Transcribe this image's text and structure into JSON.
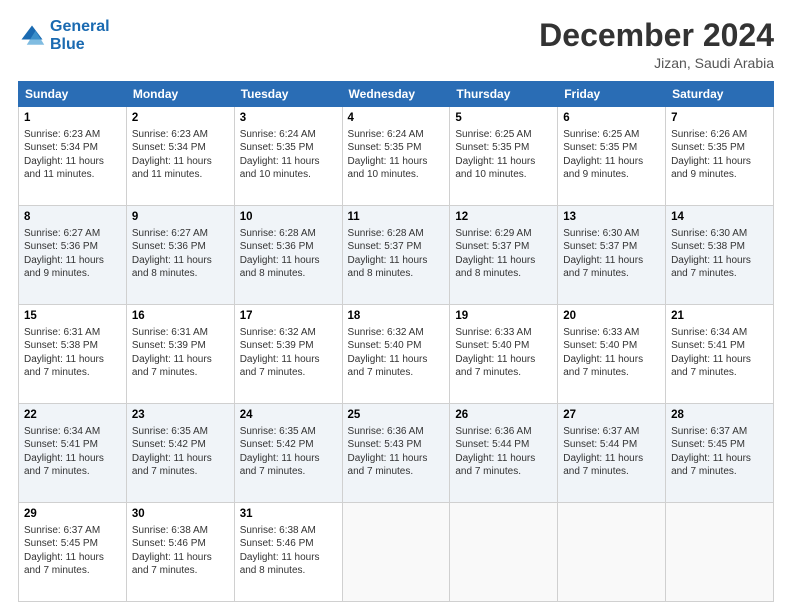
{
  "header": {
    "logo_line1": "General",
    "logo_line2": "Blue",
    "month_title": "December 2024",
    "location": "Jizan, Saudi Arabia"
  },
  "weekdays": [
    "Sunday",
    "Monday",
    "Tuesday",
    "Wednesday",
    "Thursday",
    "Friday",
    "Saturday"
  ],
  "weeks": [
    [
      {
        "day": "1",
        "sunrise": "6:23 AM",
        "sunset": "5:34 PM",
        "daylight": "11 hours and 11 minutes."
      },
      {
        "day": "2",
        "sunrise": "6:23 AM",
        "sunset": "5:34 PM",
        "daylight": "11 hours and 11 minutes."
      },
      {
        "day": "3",
        "sunrise": "6:24 AM",
        "sunset": "5:35 PM",
        "daylight": "11 hours and 10 minutes."
      },
      {
        "day": "4",
        "sunrise": "6:24 AM",
        "sunset": "5:35 PM",
        "daylight": "11 hours and 10 minutes."
      },
      {
        "day": "5",
        "sunrise": "6:25 AM",
        "sunset": "5:35 PM",
        "daylight": "11 hours and 10 minutes."
      },
      {
        "day": "6",
        "sunrise": "6:25 AM",
        "sunset": "5:35 PM",
        "daylight": "11 hours and 9 minutes."
      },
      {
        "day": "7",
        "sunrise": "6:26 AM",
        "sunset": "5:35 PM",
        "daylight": "11 hours and 9 minutes."
      }
    ],
    [
      {
        "day": "8",
        "sunrise": "6:27 AM",
        "sunset": "5:36 PM",
        "daylight": "11 hours and 9 minutes."
      },
      {
        "day": "9",
        "sunrise": "6:27 AM",
        "sunset": "5:36 PM",
        "daylight": "11 hours and 8 minutes."
      },
      {
        "day": "10",
        "sunrise": "6:28 AM",
        "sunset": "5:36 PM",
        "daylight": "11 hours and 8 minutes."
      },
      {
        "day": "11",
        "sunrise": "6:28 AM",
        "sunset": "5:37 PM",
        "daylight": "11 hours and 8 minutes."
      },
      {
        "day": "12",
        "sunrise": "6:29 AM",
        "sunset": "5:37 PM",
        "daylight": "11 hours and 8 minutes."
      },
      {
        "day": "13",
        "sunrise": "6:30 AM",
        "sunset": "5:37 PM",
        "daylight": "11 hours and 7 minutes."
      },
      {
        "day": "14",
        "sunrise": "6:30 AM",
        "sunset": "5:38 PM",
        "daylight": "11 hours and 7 minutes."
      }
    ],
    [
      {
        "day": "15",
        "sunrise": "6:31 AM",
        "sunset": "5:38 PM",
        "daylight": "11 hours and 7 minutes."
      },
      {
        "day": "16",
        "sunrise": "6:31 AM",
        "sunset": "5:39 PM",
        "daylight": "11 hours and 7 minutes."
      },
      {
        "day": "17",
        "sunrise": "6:32 AM",
        "sunset": "5:39 PM",
        "daylight": "11 hours and 7 minutes."
      },
      {
        "day": "18",
        "sunrise": "6:32 AM",
        "sunset": "5:40 PM",
        "daylight": "11 hours and 7 minutes."
      },
      {
        "day": "19",
        "sunrise": "6:33 AM",
        "sunset": "5:40 PM",
        "daylight": "11 hours and 7 minutes."
      },
      {
        "day": "20",
        "sunrise": "6:33 AM",
        "sunset": "5:40 PM",
        "daylight": "11 hours and 7 minutes."
      },
      {
        "day": "21",
        "sunrise": "6:34 AM",
        "sunset": "5:41 PM",
        "daylight": "11 hours and 7 minutes."
      }
    ],
    [
      {
        "day": "22",
        "sunrise": "6:34 AM",
        "sunset": "5:41 PM",
        "daylight": "11 hours and 7 minutes."
      },
      {
        "day": "23",
        "sunrise": "6:35 AM",
        "sunset": "5:42 PM",
        "daylight": "11 hours and 7 minutes."
      },
      {
        "day": "24",
        "sunrise": "6:35 AM",
        "sunset": "5:42 PM",
        "daylight": "11 hours and 7 minutes."
      },
      {
        "day": "25",
        "sunrise": "6:36 AM",
        "sunset": "5:43 PM",
        "daylight": "11 hours and 7 minutes."
      },
      {
        "day": "26",
        "sunrise": "6:36 AM",
        "sunset": "5:44 PM",
        "daylight": "11 hours and 7 minutes."
      },
      {
        "day": "27",
        "sunrise": "6:37 AM",
        "sunset": "5:44 PM",
        "daylight": "11 hours and 7 minutes."
      },
      {
        "day": "28",
        "sunrise": "6:37 AM",
        "sunset": "5:45 PM",
        "daylight": "11 hours and 7 minutes."
      }
    ],
    [
      {
        "day": "29",
        "sunrise": "6:37 AM",
        "sunset": "5:45 PM",
        "daylight": "11 hours and 7 minutes."
      },
      {
        "day": "30",
        "sunrise": "6:38 AM",
        "sunset": "5:46 PM",
        "daylight": "11 hours and 7 minutes."
      },
      {
        "day": "31",
        "sunrise": "6:38 AM",
        "sunset": "5:46 PM",
        "daylight": "11 hours and 8 minutes."
      },
      null,
      null,
      null,
      null
    ]
  ]
}
